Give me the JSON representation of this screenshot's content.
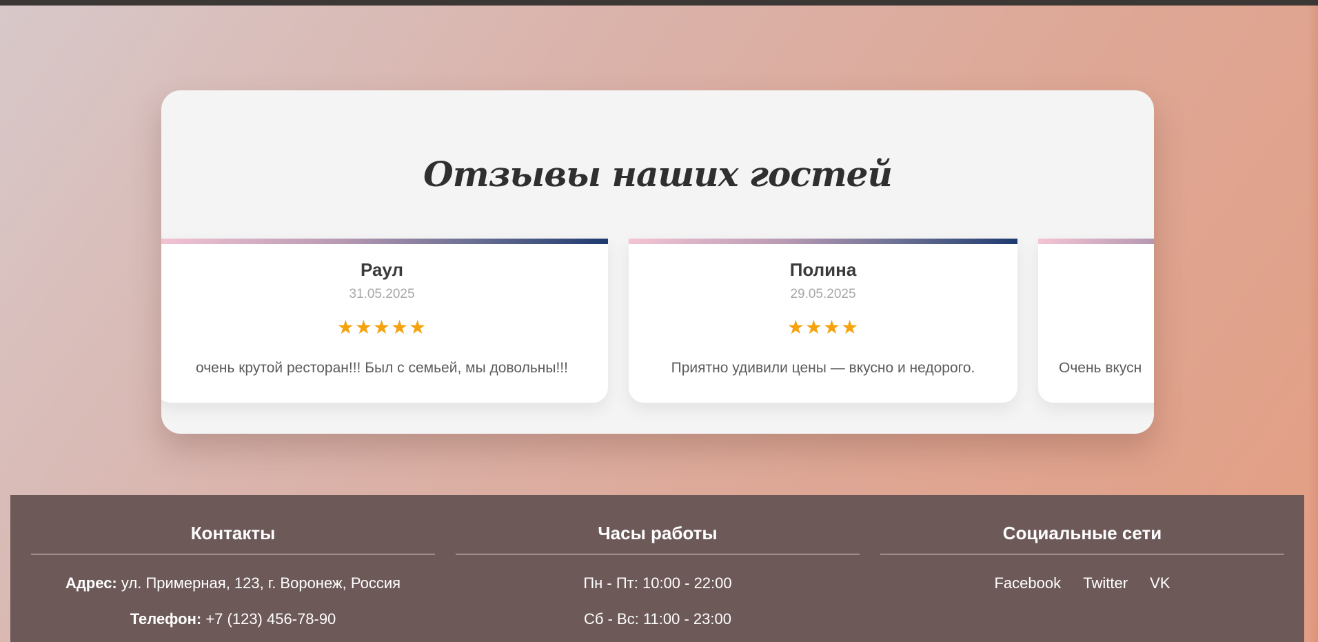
{
  "reviews": {
    "title": "Отзывы наших гостей",
    "items": [
      {
        "name": "Раул",
        "date": "31.05.2025",
        "stars": "★★★★★",
        "rating": 5,
        "text": "очень крутой ресторан!!! Был с семьей, мы довольны!!!"
      },
      {
        "name": "Полина",
        "date": "29.05.2025",
        "stars": "★★★★",
        "rating": 4,
        "text": "Приятно удивили цены — вкусно и недорого."
      },
      {
        "text": "Очень вкусн"
      }
    ]
  },
  "footer": {
    "contacts": {
      "heading": "Контакты",
      "address_label": "Адрес:",
      "address_value": "ул. Примерная, 123, г. Воронеж, Россия",
      "phone_label": "Телефон:",
      "phone_value": "+7 (123) 456-78-90"
    },
    "hours": {
      "heading": "Часы работы",
      "weekdays": "Пн - Пт: 10:00 - 22:00",
      "weekend": "Сб - Вс: 11:00 - 23:00"
    },
    "social": {
      "heading": "Социальные сети",
      "links": [
        "Facebook",
        "Twitter",
        "VK"
      ]
    }
  },
  "colors": {
    "star": "#f4a20f",
    "footer_bg": "#6e5959",
    "panel_bg": "#f4f4f4",
    "accent_start": "#f4c4d4",
    "accent_end": "#1e3a6f"
  }
}
